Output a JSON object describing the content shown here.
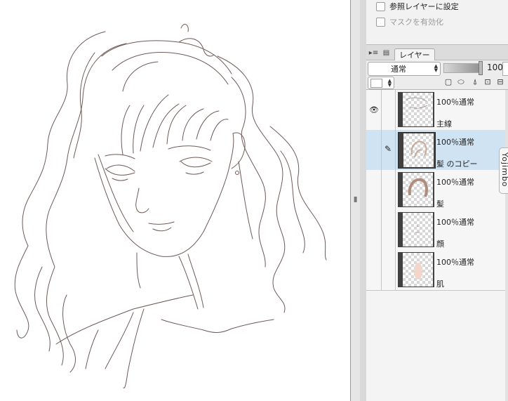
{
  "properties": {
    "reference_layer_label": "参照レイヤーに設定",
    "mask_enable_label": "マスクを有効化"
  },
  "layer_panel": {
    "tab_label": "レイヤー",
    "blend_mode": "通常",
    "opacity_value": "100",
    "layers": [
      {
        "info": "100％通常",
        "name": "主線",
        "visible": true,
        "selected": false
      },
      {
        "info": "100％通常",
        "name": "髪 のコピー",
        "visible": false,
        "selected": true,
        "editing": true
      },
      {
        "info": "100％通常",
        "name": "髪",
        "visible": false,
        "selected": false
      },
      {
        "info": "100％通常",
        "name": "顔",
        "visible": false,
        "selected": false
      },
      {
        "info": "100％通常",
        "name": "肌",
        "visible": false,
        "selected": false
      }
    ]
  },
  "side_tab_label": "Yojimbo",
  "icons": {
    "eye": "eye-icon",
    "pen": "pen-icon",
    "lock": "lock-icon"
  }
}
